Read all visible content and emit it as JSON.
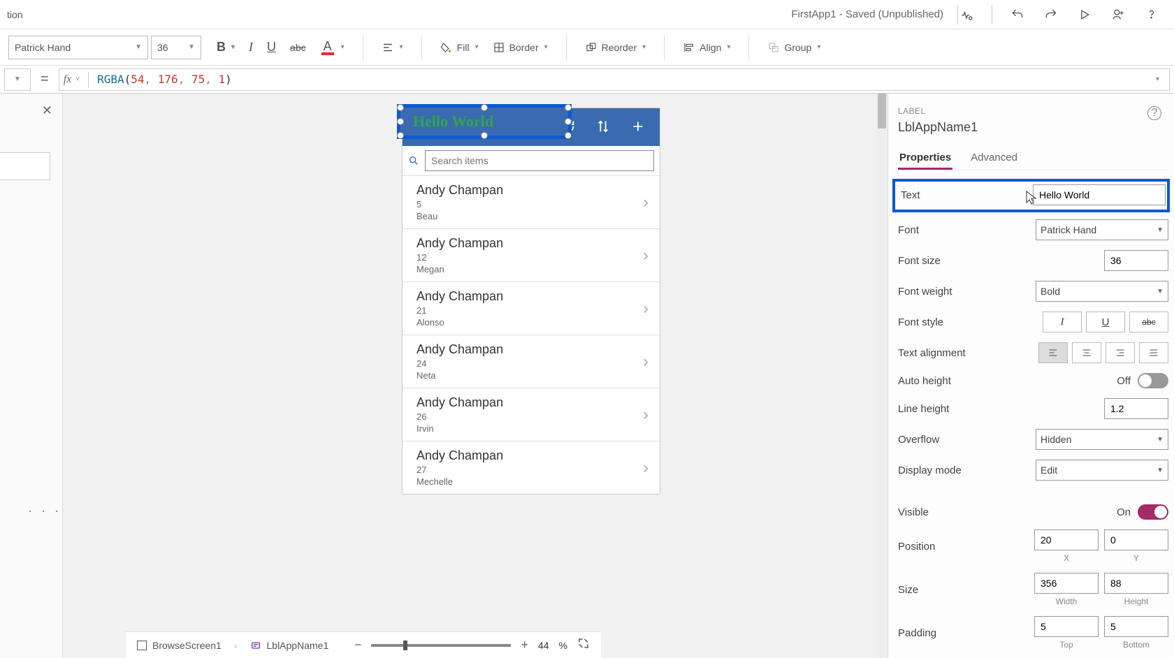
{
  "top": {
    "partial_word": "tion",
    "app_title": "FirstApp1 - Saved (Unpublished)"
  },
  "toolbar": {
    "font_name": "Patrick Hand",
    "font_size": "36",
    "fill_label": "Fill",
    "border_label": "Border",
    "reorder_label": "Reorder",
    "align_label": "Align",
    "group_label": "Group"
  },
  "formula": {
    "fn": "RGBA",
    "args": [
      "54",
      "176",
      "75",
      "1"
    ]
  },
  "canvas": {
    "selected_text": "Hello World",
    "search_placeholder": "Search items",
    "items": [
      {
        "title": "Andy Champan",
        "sub1": "5",
        "sub2": "Beau"
      },
      {
        "title": "Andy Champan",
        "sub1": "12",
        "sub2": "Megan"
      },
      {
        "title": "Andy Champan",
        "sub1": "21",
        "sub2": "Alonso"
      },
      {
        "title": "Andy Champan",
        "sub1": "24",
        "sub2": "Neta"
      },
      {
        "title": "Andy Champan",
        "sub1": "26",
        "sub2": "Irvin"
      },
      {
        "title": "Andy Champan",
        "sub1": "27",
        "sub2": "Mechelle"
      }
    ]
  },
  "breadcrumb": {
    "screen": "BrowseScreen1",
    "control": "LblAppName1"
  },
  "zoom": {
    "pct": "44",
    "pct_suffix": "%"
  },
  "panel": {
    "label": "LABEL",
    "name": "LblAppName1",
    "tab_properties": "Properties",
    "tab_advanced": "Advanced",
    "props": {
      "text_label": "Text",
      "text_value": "Hello World",
      "font_label": "Font",
      "font_value": "Patrick Hand",
      "fontsize_label": "Font size",
      "fontsize_value": "36",
      "fontweight_label": "Font weight",
      "fontweight_value": "Bold",
      "fontstyle_label": "Font style",
      "textalign_label": "Text alignment",
      "autoheight_label": "Auto height",
      "autoheight_value": "Off",
      "lineheight_label": "Line height",
      "lineheight_value": "1.2",
      "overflow_label": "Overflow",
      "overflow_value": "Hidden",
      "displaymode_label": "Display mode",
      "displaymode_value": "Edit",
      "visible_label": "Visible",
      "visible_value": "On",
      "position_label": "Position",
      "position_x": "20",
      "position_y": "0",
      "x_label": "X",
      "y_label": "Y",
      "size_label": "Size",
      "size_w": "356",
      "size_h": "88",
      "w_label": "Width",
      "h_label": "Height",
      "padding_label": "Padding",
      "pad_top": "5",
      "pad_bottom": "5",
      "top_label": "Top",
      "bottom_label": "Bottom"
    }
  }
}
